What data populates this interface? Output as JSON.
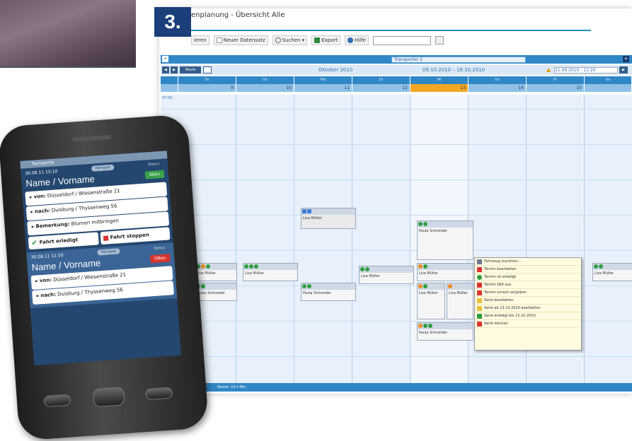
{
  "step_number": "3.",
  "window": {
    "title": "enplanung - Übersicht Alle"
  },
  "toolbar": {
    "print": "ieren",
    "new_record": "Neuer Datensatz",
    "search": "Suchen",
    "export": "Export",
    "help": "Hilfe"
  },
  "filter": {
    "selected": "Transporter 2"
  },
  "nav": {
    "today": "Heute",
    "month": "Oktober 2010",
    "range": "09.10.2010 – 18.10.2010",
    "stamp": "11.09.2010 - 11:20"
  },
  "days": [
    {
      "name": "So",
      "num": "9"
    },
    {
      "name": "Do",
      "num": "10"
    },
    {
      "name": "Mo",
      "num": "11"
    },
    {
      "name": "Di",
      "num": "12"
    },
    {
      "name": "Mi",
      "num": "13"
    },
    {
      "name": "Do",
      "num": "14"
    },
    {
      "name": "Fr",
      "num": "15"
    },
    {
      "name": "Sa",
      "num": ""
    }
  ],
  "time_first": "07:00",
  "entries": {
    "e1": "Lisa Müller",
    "e2": "Paula Schneider",
    "e3": "Lisa Müller",
    "e4": "Lisa Müller",
    "e5": "Paula Schneider",
    "e6": "Lisa Müller",
    "e7": "Lisa Müller",
    "e8": "Lisa Müller",
    "e9": "Paula Schneider",
    "e10": "Lisa Müller",
    "e11": "Paula Schneider",
    "e12": "Lisa Müller"
  },
  "context_menu": [
    "Fahrzeug zuordnen...",
    "Termin bearbeiten",
    "Termin ist erledigt",
    "Termin fällt aus",
    "Termin erneut vergeben",
    "Serie bearbeiten",
    "Serie ab 13.10.2010 bearbeiten",
    "Serie erledigt bis 13.10.2010",
    "Serie löschen"
  ],
  "status_bar": {
    "text": "Raster: 10 ▾ Min."
  },
  "phone": {
    "app_title": "Transporte",
    "card1": {
      "time": "30.08.11 15:10",
      "call_label": "Fahrgast",
      "status_label": "Status",
      "name": "Name / Vorname",
      "status": "Aktiv",
      "from_label": "von:",
      "from": "Düsseldorf / Wiesenstraße 21",
      "to_label": "nach:",
      "to": "Duisburg / Thyssenweg 56",
      "note_label": "Bemerkung:",
      "note": "Blumen mitbringen",
      "done": "Fahrt erledigt",
      "stop": "Fahrt stoppen"
    },
    "card2": {
      "time": "30.08.11 11:10",
      "call_label": "Fahrgast",
      "status_label": "Status",
      "name": "Name / Vorname",
      "status": "Offen",
      "from_label": "von:",
      "from": "Düsseldorf / Wiesenstraße 21",
      "to_label": "nach:",
      "to": "Duisburg / Thyssenweg 56"
    }
  }
}
